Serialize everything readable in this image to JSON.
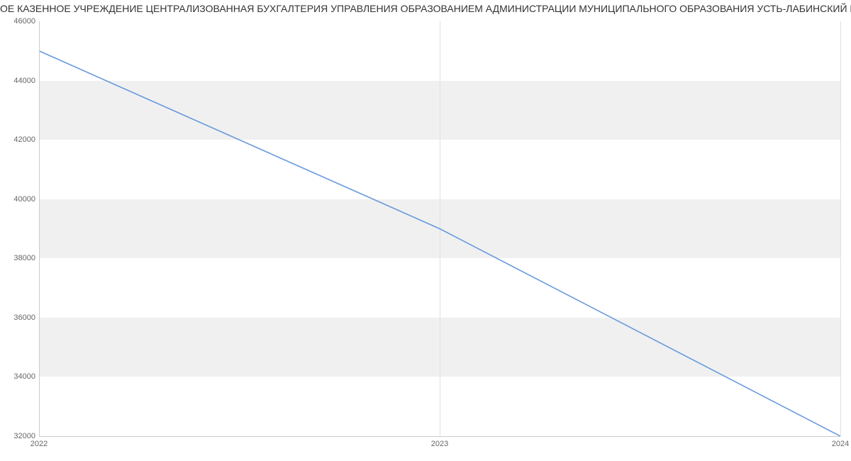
{
  "chart_data": {
    "type": "line",
    "title": "ОЕ КАЗЕННОЕ УЧРЕЖДЕНИЕ ЦЕНТРАЛИЗОВАННАЯ БУХГАЛТЕРИЯ УПРАВЛЕНИЯ ОБРАЗОВАНИЕМ АДМИНИСТРАЦИИ МУНИЦИПАЛЬНОГО ОБРАЗОВАНИЯ УСТЬ-ЛАБИНСКИЙ Р",
    "x": [
      2022,
      2023,
      2024
    ],
    "values": [
      45000,
      39000,
      32000
    ],
    "xticks": [
      2022,
      2023,
      2024
    ],
    "yticks": [
      32000,
      34000,
      36000,
      38000,
      40000,
      42000,
      44000,
      46000
    ],
    "ylim": [
      32000,
      46000
    ],
    "xlim": [
      2022,
      2024
    ],
    "line_color": "#6699dd"
  }
}
